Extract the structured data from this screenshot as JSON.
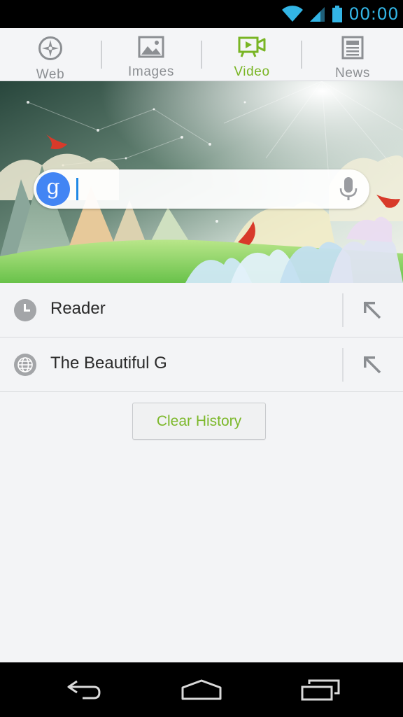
{
  "status_bar": {
    "time": "00:00",
    "accent_color": "#33b5e5",
    "icons": [
      "wifi-icon",
      "cell-signal-icon",
      "battery-icon"
    ]
  },
  "tabs": [
    {
      "label": "Web",
      "icon": "compass-icon",
      "active": false
    },
    {
      "label": "Images",
      "icon": "image-icon",
      "active": false
    },
    {
      "label": "Video",
      "icon": "video-camera-icon",
      "active": true
    },
    {
      "label": "News",
      "icon": "newspaper-icon",
      "active": false
    }
  ],
  "search": {
    "value": "",
    "badge_letter": "g",
    "badge_color": "#4285f4",
    "voice_icon": "microphone-icon"
  },
  "history": [
    {
      "label": "Reader",
      "icon": "clock-icon",
      "action_icon": "arrow-up-left-icon"
    },
    {
      "label": "The Beautiful G",
      "icon": "globe-icon",
      "action_icon": "arrow-up-left-icon"
    }
  ],
  "clear_history_label": "Clear History",
  "colors": {
    "active_tab": "#79b524",
    "inactive_tab": "#8c8f93",
    "clear_button_text": "#7cb82a"
  },
  "nav_bar": {
    "buttons": [
      "back-icon",
      "home-icon",
      "recent-apps-icon"
    ]
  }
}
